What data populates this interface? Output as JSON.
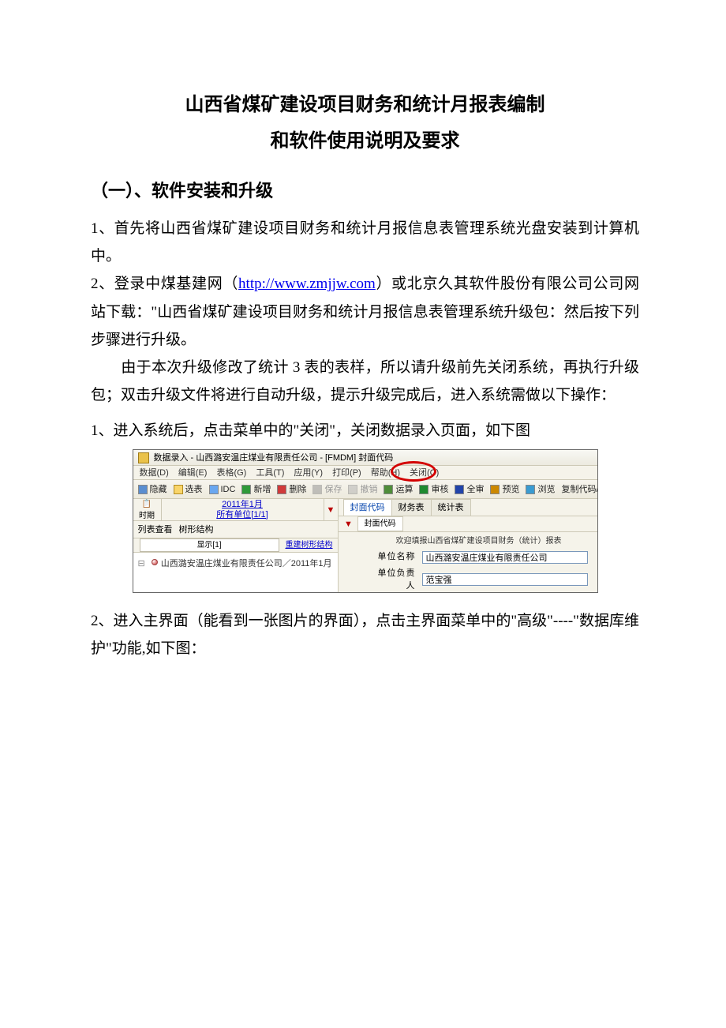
{
  "title": "山西省煤矿建设项目财务和统计月报表编制",
  "subtitle": "和软件使用说明及要求",
  "section1_header": "（一）、软件安装和升级",
  "p1a": "1、首先将山西省煤矿建设项目财务和统计月报信息表管理系统光盘安装到计算机中。",
  "p2a_pre": "2、登录中煤基建网（",
  "p2a_link": "http://www.zmjjw.com",
  "p2a_post": "）或北京久其软件股份有限公司公司网站下载：\"山西省煤矿建设项目财务和统计月报信息表管理系统升级包：然后按下列步骤进行升级。",
  "p_indent": "由于本次升级修改了统计 3 表的表样，所以请升级前先关闭系统，再执行升级包；双击升级文件将进行自动升级，提示升级完成后，进入系统需做以下操作：",
  "p_step1": "1、进入系统后，点击菜单中的\"关闭\"，关闭数据录入页面，如下图",
  "p_step2": "2、进入主界面（能看到一张图片的界面），点击主界面菜单中的\"高级\"----\"数据库维护\"功能,如下图：",
  "app": {
    "window_title": "数据录入 - 山西潞安温庄煤业有限责任公司 - [FMDM] 封面代码",
    "menu": {
      "data": "数据(D)",
      "edit": "编辑(E)",
      "table": "表格(G)",
      "tool": "工具(T)",
      "app": "应用(Y)",
      "print": "打印(P)",
      "help": "帮助(H)",
      "close": "关闭(C)"
    },
    "toolbar": {
      "hide": "隐藏",
      "select": "选表",
      "idc": "IDC",
      "new": "新增",
      "del": "删除",
      "save": "保存",
      "undo": "撤销",
      "calc": "运算",
      "check": "审核",
      "allcheck": "全审",
      "preview": "预览",
      "view": "浏览",
      "copycode": "复制代码/有"
    },
    "left": {
      "period_title": "时期",
      "period_link1": "2011年1月",
      "period_link2": "所有单位[1/1]",
      "list_view": "列表查看",
      "tree_view": "树形结构",
      "display_count": "显示[1]",
      "rebuild": "重建树形结构",
      "node": "山西潞安温庄煤业有限责任公司／2011年1月"
    },
    "right": {
      "tab_cover": "封面代码",
      "tab_fin": "财务表",
      "tab_stat": "统计表",
      "subtab_cover": "封面代码",
      "form_title": "欢迎填报山西省煤矿建设项目财务（统计）报表",
      "lbl_unit": "单位名称",
      "val_unit": "山西潞安温庄煤业有限责任公司",
      "lbl_leader": "单位负责人",
      "val_leader": "范宝强"
    }
  }
}
